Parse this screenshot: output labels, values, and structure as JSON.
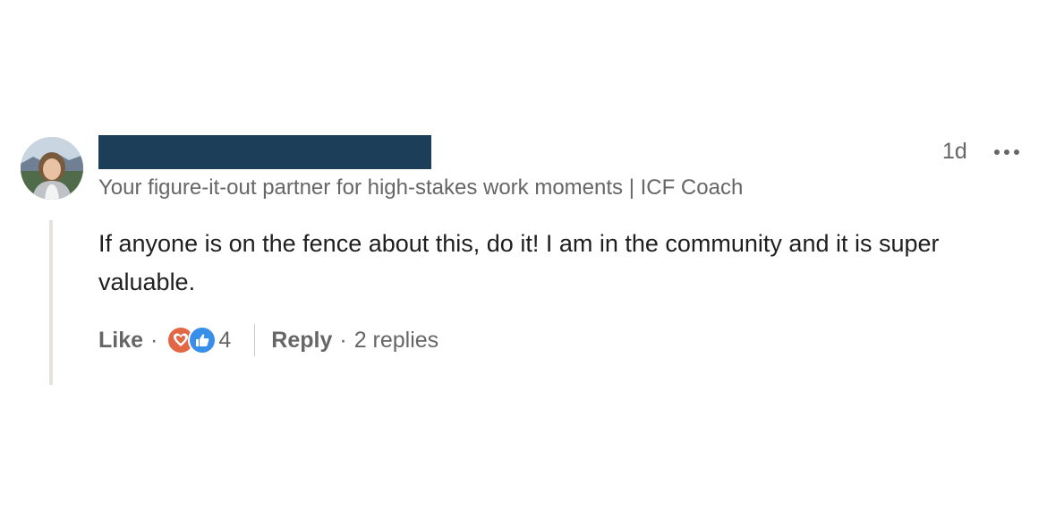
{
  "comment": {
    "headline": "Your figure-it-out partner for high-stakes work moments | ICF Coach",
    "timestamp": "1d",
    "body": "If anyone is on the fence about this, do it! I am in the community and it is super valuable.",
    "more_icon": "ellipsis-icon",
    "avatar_icon": "profile-photo"
  },
  "actions": {
    "like_label": "Like",
    "dot": "·",
    "reaction_icons": [
      "love-icon",
      "like-icon"
    ],
    "reaction_count": "4",
    "reply_label": "Reply",
    "replies_label": "2 replies"
  },
  "colors": {
    "redaction": "#1d3e58",
    "secondary_text": "#666666",
    "love": "#e16745",
    "like": "#378fe9"
  }
}
